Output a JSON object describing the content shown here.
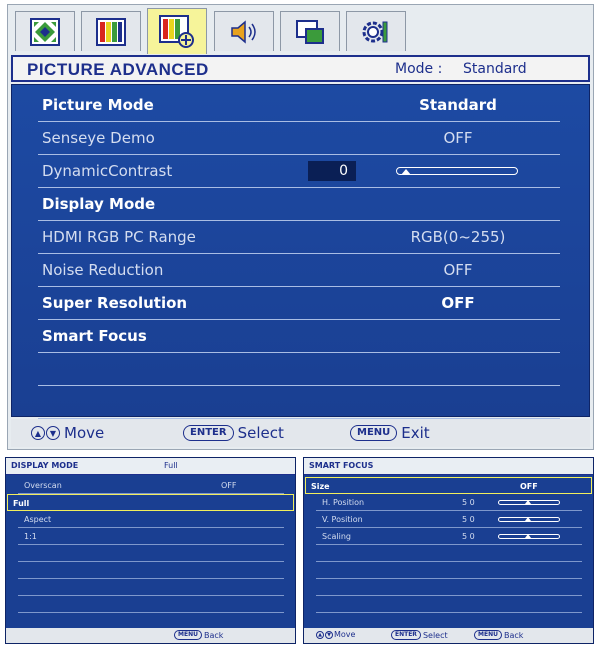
{
  "tabs": [
    {
      "icon": "picture-pattern-icon"
    },
    {
      "icon": "color-bars-icon"
    },
    {
      "icon": "picture-advanced-icon",
      "active": true
    },
    {
      "icon": "speaker-icon"
    },
    {
      "icon": "display-windows-icon"
    },
    {
      "icon": "setup-gear-icon"
    }
  ],
  "main": {
    "title": "PICTURE ADVANCED",
    "mode_label": "Mode :",
    "mode_value": "Standard",
    "rows": [
      {
        "label": "Picture Mode",
        "value": "Standard",
        "bold": true
      },
      {
        "label": "Senseye Demo",
        "value": "OFF"
      },
      {
        "label": "DynamicContrast",
        "value": "0",
        "slider_fraction": 0.0
      },
      {
        "label": "Display Mode",
        "value": "",
        "bold": true
      },
      {
        "label": "HDMI RGB PC Range",
        "value": "RGB(0~255)"
      },
      {
        "label": "Noise Reduction",
        "value": "OFF"
      },
      {
        "label": "Super Resolution",
        "value": "OFF",
        "bold": true
      },
      {
        "label": "Smart Focus",
        "value": "",
        "bold": true
      },
      {
        "label": "",
        "value": ""
      }
    ],
    "footer": {
      "move": "Move",
      "enter_key": "ENTER",
      "select": "Select",
      "menu_key": "MENU",
      "exit": "Exit"
    }
  },
  "display_mode": {
    "title": "DISPLAY MODE",
    "current": "Full",
    "rows": [
      {
        "label": "Overscan",
        "value": "OFF"
      },
      {
        "label": "Full",
        "value": "",
        "selected": true
      },
      {
        "label": "Aspect",
        "value": ""
      },
      {
        "label": "1:1",
        "value": ""
      }
    ],
    "footer": {
      "menu_key": "MENU",
      "back": "Back"
    }
  },
  "smart_focus": {
    "title": "SMART FOCUS",
    "rows": [
      {
        "label": "Size",
        "value": "OFF",
        "selected": true
      },
      {
        "label": "H. Position",
        "value": "5 0",
        "slider_fraction": 0.5
      },
      {
        "label": "V. Position",
        "value": "5 0",
        "slider_fraction": 0.5
      },
      {
        "label": "Scaling",
        "value": "5 0",
        "slider_fraction": 0.5
      }
    ],
    "footer": {
      "move": "Move",
      "enter_key": "ENTER",
      "select": "Select",
      "menu_key": "MENU",
      "back": "Back"
    }
  }
}
